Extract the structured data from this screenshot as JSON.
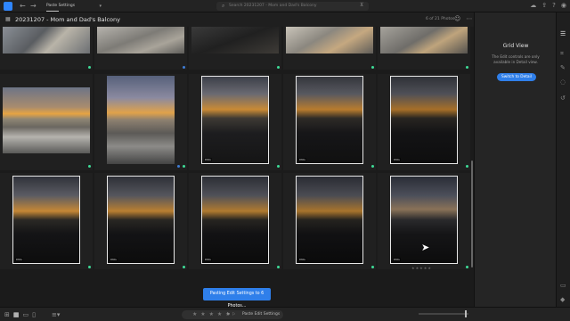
{
  "topbar": {
    "tab_label": "Paste Settings",
    "search_placeholder": "Search 20231207 - Mom and Dad's Balcony",
    "icons": [
      "back-icon",
      "forward-icon",
      "filter-icon",
      "cloud-icon",
      "share-icon",
      "help-icon",
      "account-icon"
    ]
  },
  "header": {
    "album_title": "20231207 - Mom and Dad's Balcony",
    "count_text": "6 of 21 Photos"
  },
  "grid": {
    "rows": [
      {
        "photos": [
          {
            "kind": "day"
          },
          {
            "kind": "day"
          },
          {
            "kind": "dark"
          },
          {
            "kind": "day"
          },
          {
            "kind": "day"
          }
        ]
      },
      {
        "photos": [
          {
            "kind": "sunset-wide"
          },
          {
            "kind": "sunset-tall"
          },
          {
            "kind": "sunset-dark",
            "badge": "DNG"
          },
          {
            "kind": "sunset-dark",
            "badge": "DNG"
          },
          {
            "kind": "sunset-dark",
            "badge": "DNG"
          }
        ]
      },
      {
        "photos": [
          {
            "kind": "sunset-dark",
            "badge": "DNG"
          },
          {
            "kind": "sunset-dark",
            "badge": "DNG"
          },
          {
            "kind": "sunset-dark",
            "badge": "DNG"
          },
          {
            "kind": "sunset-dark",
            "badge": "DNG"
          },
          {
            "kind": "sunset-dark",
            "badge": "DNG"
          }
        ]
      }
    ],
    "status_color": "#3ddc97"
  },
  "right_panel": {
    "title": "Grid View",
    "description": "The Edit controls are only available in Detail view.",
    "button_label": "Switch to Detail"
  },
  "progress_pill": "Pasting Edit Settings to 6 Photos...",
  "bottombar": {
    "stars": "★ ★ ★ ★ ★",
    "paste_label": "Paste Edit Settings"
  },
  "accent_color": "#2f7fea"
}
